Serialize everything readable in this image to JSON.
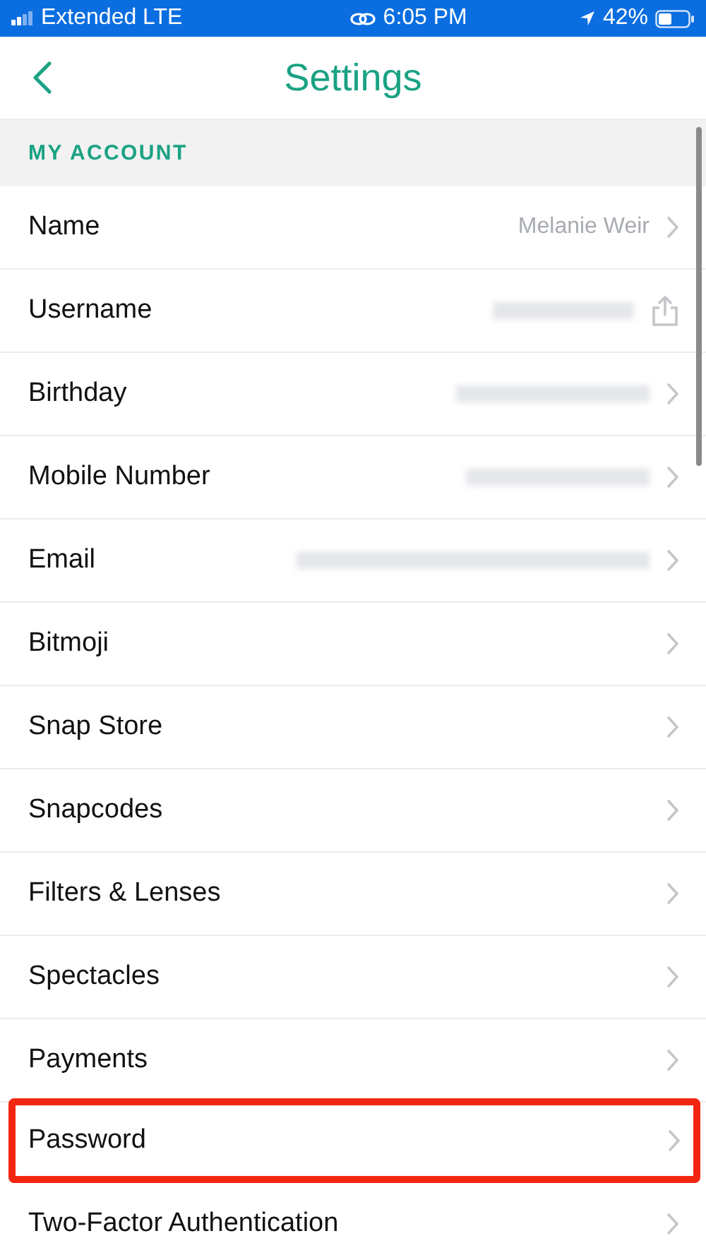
{
  "status_bar": {
    "carrier": "Extended LTE",
    "time": "6:05 PM",
    "battery": "42%"
  },
  "header": {
    "title": "Settings"
  },
  "section": {
    "title": "MY ACCOUNT"
  },
  "rows": [
    {
      "label": "Name",
      "value": "Melanie Weir",
      "kind": "chevron",
      "highlighted": false
    },
    {
      "label": "Username",
      "redacted": true,
      "kind": "share",
      "highlighted": false
    },
    {
      "label": "Birthday",
      "redacted": true,
      "kind": "chevron",
      "highlighted": false
    },
    {
      "label": "Mobile Number",
      "redacted": true,
      "kind": "chevron",
      "highlighted": false
    },
    {
      "label": "Email",
      "redacted": true,
      "kind": "chevron",
      "highlighted": false
    },
    {
      "label": "Bitmoji",
      "kind": "chevron",
      "highlighted": false
    },
    {
      "label": "Snap Store",
      "kind": "chevron",
      "highlighted": false
    },
    {
      "label": "Snapcodes",
      "kind": "chevron",
      "highlighted": false
    },
    {
      "label": "Filters & Lenses",
      "kind": "chevron",
      "highlighted": false
    },
    {
      "label": "Spectacles",
      "kind": "chevron",
      "highlighted": false
    },
    {
      "label": "Payments",
      "kind": "chevron",
      "highlighted": false
    },
    {
      "label": "Password",
      "kind": "chevron",
      "highlighted": true
    },
    {
      "label": "Two-Factor Authentication",
      "kind": "chevron",
      "highlighted": false
    }
  ]
}
